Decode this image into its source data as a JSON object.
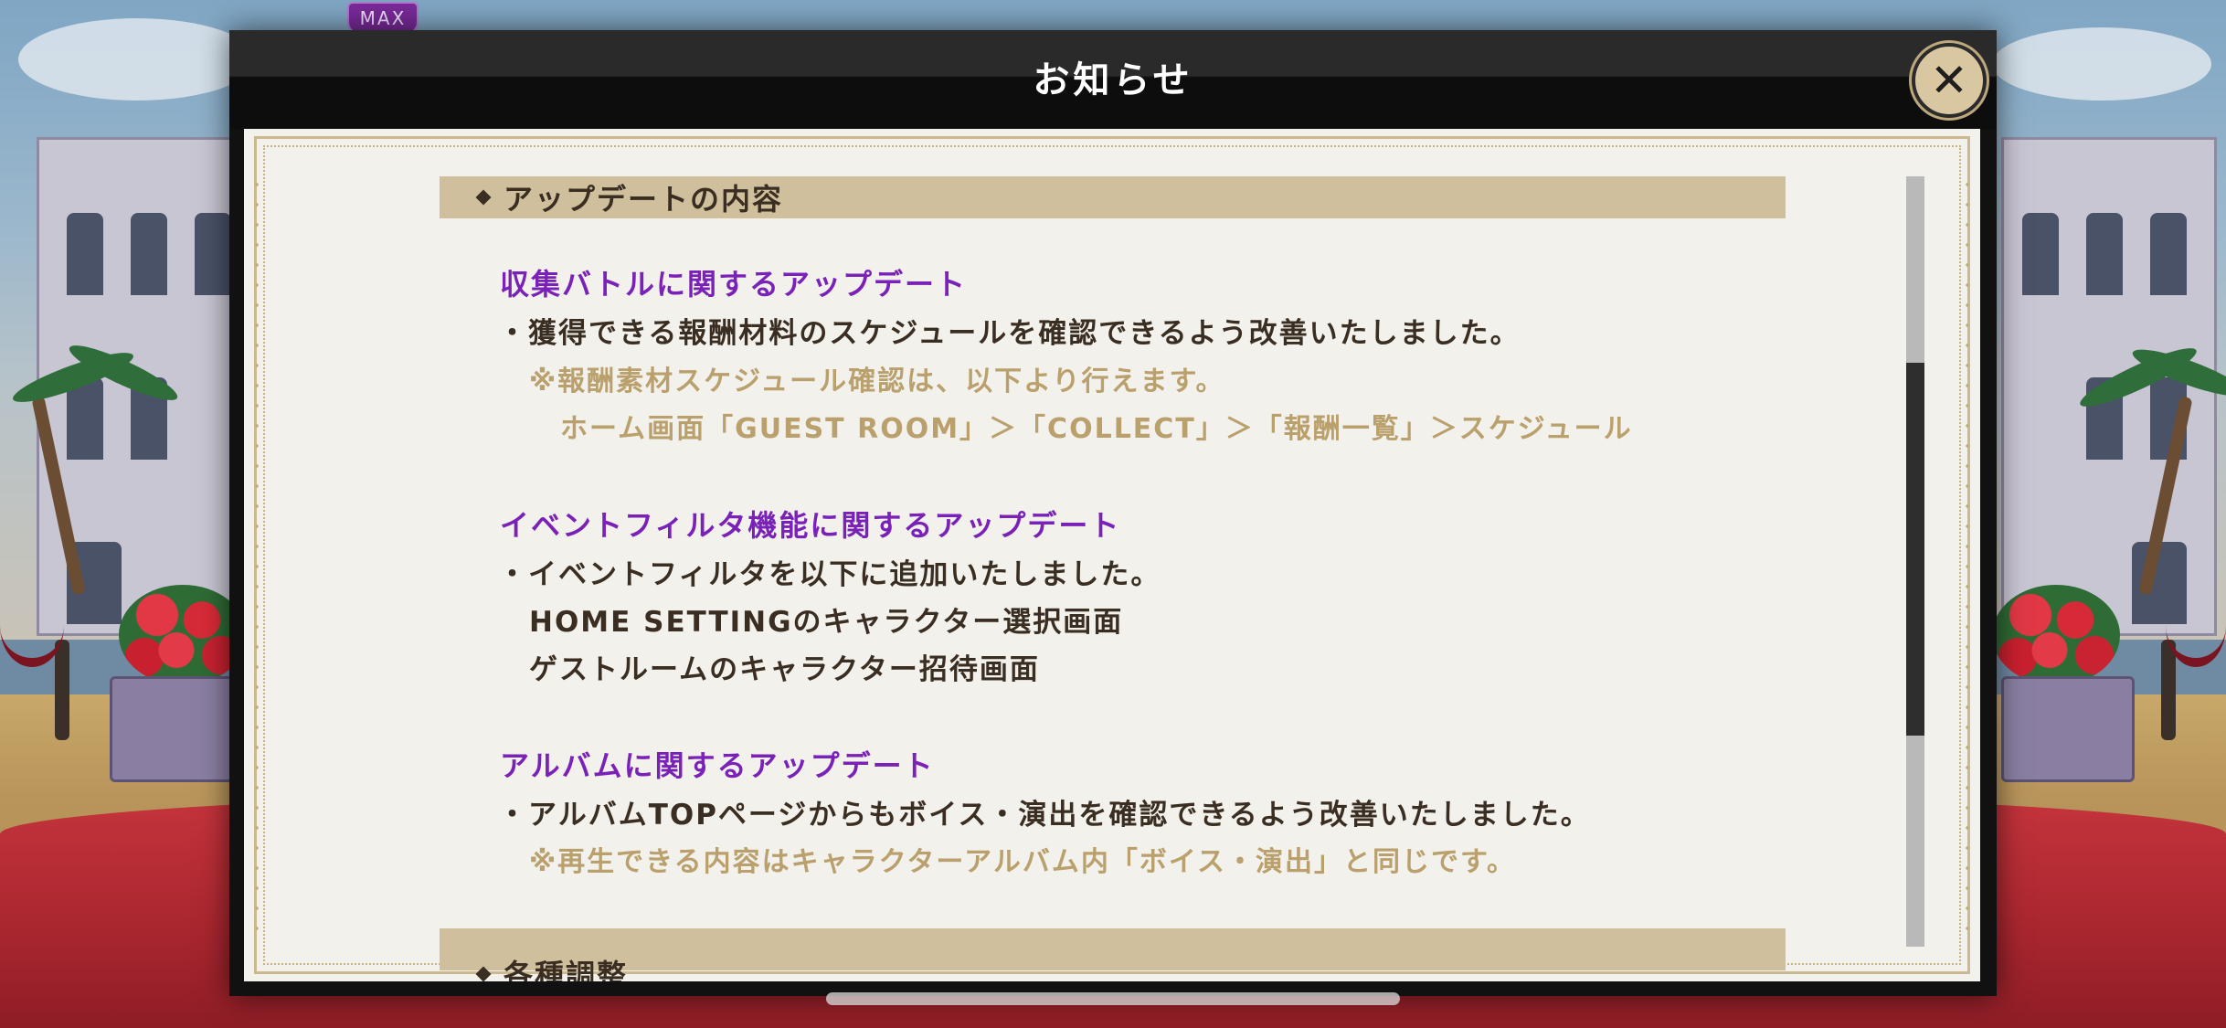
{
  "hud": {
    "max_badge": "MAX"
  },
  "modal": {
    "title": "お知らせ",
    "close_icon": "close-icon"
  },
  "notice": {
    "sections": [
      {
        "heading": "アップデートの内容",
        "blocks": [
          {
            "title": "収集バトルに関するアップデート",
            "lines": [
              "・獲得できる報酬材料のスケジュールを確認できるよう改善いたしました。"
            ],
            "notes": [
              "※報酬素材スケジュール確認は、以下より行えます。",
              "ホーム画面「GUEST ROOM」＞「COLLECT」＞「報酬一覧」＞スケジュール"
            ]
          },
          {
            "title": "イベントフィルタ機能に関するアップデート",
            "lines": [
              "・イベントフィルタを以下に追加いたしました。",
              "HOME SETTINGのキャラクター選択画面",
              "ゲストルームのキャラクター招待画面"
            ]
          },
          {
            "title": "アルバムに関するアップデート",
            "lines": [
              "・アルバムTOPページからもボイス・演出を確認できるよう改善いたしました。"
            ],
            "notes": [
              "※再生できる内容はキャラクターアルバム内「ボイス・演出」と同じです。"
            ]
          }
        ]
      },
      {
        "heading": "各種調整"
      }
    ]
  },
  "colors": {
    "section_bar": "#cfbf9c",
    "heading_purple": "#7a22b8",
    "body_text": "#3a2e22",
    "note_gold": "#b9a06c",
    "paper": "#f3f1ec",
    "frame": "#cbb98f"
  }
}
